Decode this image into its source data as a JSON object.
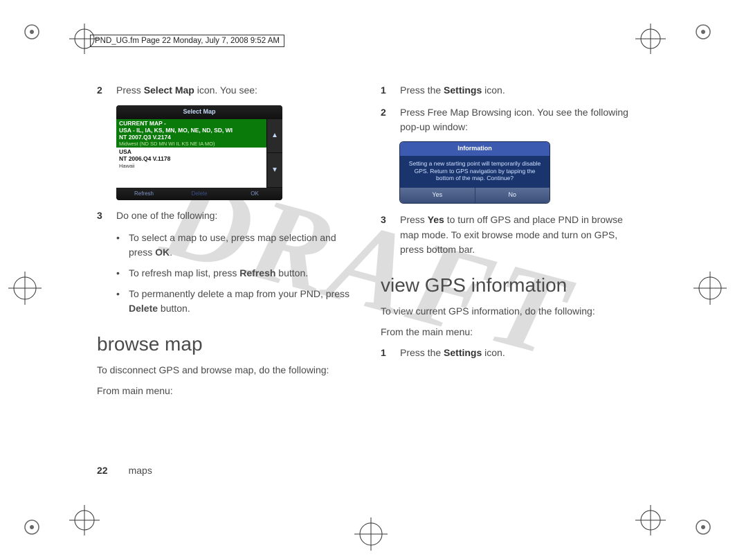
{
  "header_stamp": "PND_UG.fm  Page 22  Monday, July 7, 2008  9:52 AM",
  "watermark": "DRAFT",
  "left_col": {
    "step2_num": "2",
    "step2_a": "Press ",
    "step2_b": "Select Map",
    "step2_c": " icon. You see:",
    "select_map": {
      "title": "Select Map",
      "row1_line1": "CURRENT MAP -",
      "row1_line2": "USA - IL, IA, KS, MN, MO, NE, ND, SD, WI",
      "row1_line3": "NT 2007.Q3 V.2174",
      "row1_region": "Midwest  (ND SD MN WI IL KS NE IA MO)",
      "row2_line1": "USA",
      "row2_line2": "NT 2006.Q4 V.1178",
      "row2_region": "Hawaii",
      "btn_refresh": "Refresh",
      "btn_delete": "Delete",
      "btn_ok": "OK"
    },
    "step3_num": "3",
    "step3_text": "Do one of the following:",
    "bullet1_a": "To select a map to use, press map selection and press ",
    "bullet1_b": "OK",
    "bullet1_c": ".",
    "bullet2_a": "To refresh map list, press ",
    "bullet2_b": "Refresh",
    "bullet2_c": " button.",
    "bullet3_a": "To permanently delete a map from your PND, press ",
    "bullet3_b": "Delete",
    "bullet3_c": " button.",
    "h2": "browse map",
    "para1": "To disconnect GPS and browse map, do the following:",
    "para2": "From main menu:"
  },
  "right_col": {
    "step1_num": "1",
    "step1_a": "Press the ",
    "step1_b": "Settings",
    "step1_c": " icon.",
    "step2_num": "2",
    "step2_text": "Press Free Map Browsing icon. You see the following pop-up window:",
    "popup": {
      "title": "Information",
      "body": "Setting a new starting point will temporarily disable GPS.\nReturn to GPS navigation by tapping the bottom of the map. Continue?",
      "yes": "Yes",
      "no": "No"
    },
    "step3_num": "3",
    "step3_a": "Press ",
    "step3_b": "Yes",
    "step3_c": " to turn off GPS and place PND in browse map mode. To exit browse mode and turn on GPS, press bottom bar.",
    "h2": "view GPS information",
    "para1": "To view current GPS information, do the following:",
    "para2": "From the main menu:",
    "vstep1_num": "1",
    "vstep1_a": "Press the ",
    "vstep1_b": "Settings",
    "vstep1_c": " icon."
  },
  "footer": {
    "page_num": "22",
    "section": "maps"
  }
}
